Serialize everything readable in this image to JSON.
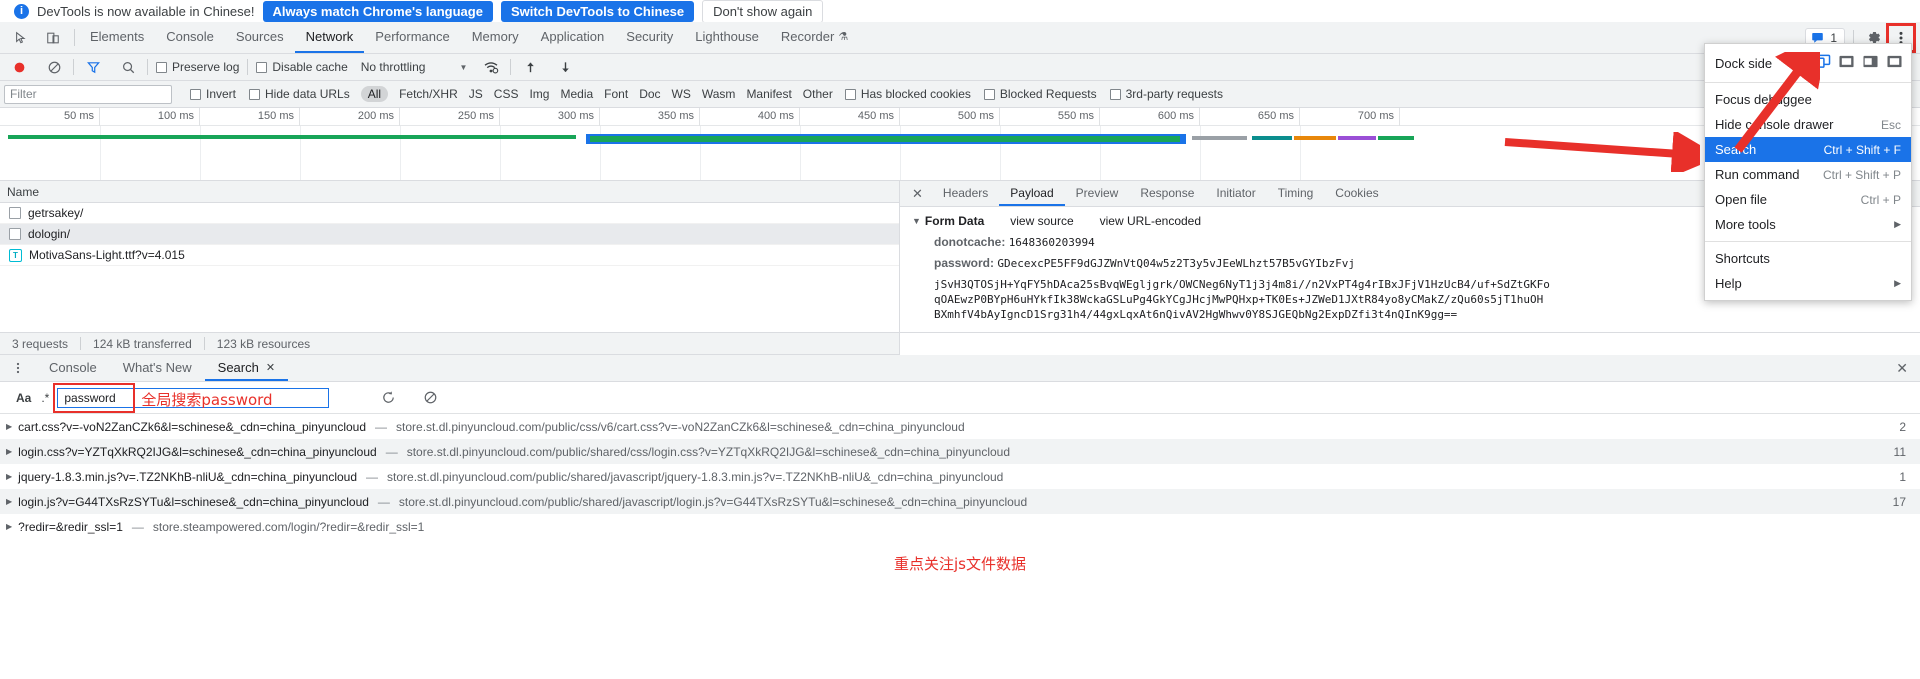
{
  "banner": {
    "icon": "info-icon",
    "text": "DevTools is now available in Chinese!",
    "primary_btn": "Always match Chrome's language",
    "secondary_btn": "Switch DevTools to Chinese",
    "dismiss_btn": "Don't show again"
  },
  "tabbar": {
    "inspect_icon": "inspect-cursor-icon",
    "device_icon": "device-toolbar-icon",
    "tabs": [
      {
        "label": "Elements",
        "active": false
      },
      {
        "label": "Console",
        "active": false
      },
      {
        "label": "Sources",
        "active": false
      },
      {
        "label": "Network",
        "active": true
      },
      {
        "label": "Performance",
        "active": false
      },
      {
        "label": "Memory",
        "active": false
      },
      {
        "label": "Application",
        "active": false
      },
      {
        "label": "Security",
        "active": false
      },
      {
        "label": "Lighthouse",
        "active": false
      },
      {
        "label": "Recorder",
        "active": false,
        "flask": "⚗"
      }
    ],
    "message_count": "1",
    "message_icon": "message-icon",
    "settings_icon": "gear-icon",
    "more_icon": "three-dots-vertical-icon"
  },
  "network_toolbar": {
    "record_icon": "record-circle-icon",
    "clear_icon": "clear-forbidden-icon",
    "filter_icon": "funnel-icon",
    "search_icon": "magnifier-icon",
    "preserve_log": "Preserve log",
    "disable_cache": "Disable cache",
    "throttling": "No throttling",
    "wifi_icon": "network-conditions-icon",
    "import_icon": "upload-arrow-icon",
    "export_icon": "download-arrow-icon"
  },
  "filter_bar": {
    "placeholder": "Filter",
    "invert": "Invert",
    "hide_data_urls": "Hide data URLs",
    "types": [
      "All",
      "Fetch/XHR",
      "JS",
      "CSS",
      "Img",
      "Media",
      "Font",
      "Doc",
      "WS",
      "Wasm",
      "Manifest",
      "Other"
    ],
    "selected_type": "All",
    "has_blocked_cookies": "Has blocked cookies",
    "blocked_requests": "Blocked Requests",
    "third_party": "3rd-party requests"
  },
  "timeline": {
    "ticks": [
      "50 ms",
      "100 ms",
      "150 ms",
      "200 ms",
      "250 ms",
      "300 ms",
      "350 ms",
      "400 ms",
      "450 ms",
      "500 ms",
      "550 ms",
      "600 ms",
      "650 ms",
      "700 ms"
    ]
  },
  "requests": {
    "column_header": "Name",
    "rows": [
      {
        "name": "getrsakey/",
        "icon": "document-icon"
      },
      {
        "name": "dologin/",
        "icon": "document-icon"
      },
      {
        "name": "MotivaSans-Light.ttf?v=4.015",
        "icon": "font-icon"
      }
    ]
  },
  "detail": {
    "close_icon": "close-x-icon",
    "tabs": [
      "Headers",
      "Payload",
      "Preview",
      "Response",
      "Initiator",
      "Timing",
      "Cookies"
    ],
    "active_tab": "Payload",
    "form_data_title": "Form Data",
    "view_source": "view source",
    "view_url_encoded": "view URL-encoded",
    "fields": [
      {
        "key": "donotcache:",
        "value": "1648360203994"
      },
      {
        "key": "password:",
        "value": "GDecexcPE5FF9dGJZWnVtQ04w5z2T3y5vJEeWLhzt57B5vGYIbzFvj"
      }
    ],
    "wrapped_lines": [
      "jSvH3QTOSjH+YqFY5hDAca25sBvqWEgljgrk/OWCNeg6NyT1j3j4m8i//n2VxPT4g4rIBxJFjV1HzUcB4/uf+SdZtGKFo",
      "qOAEwzP0BYpH6uHYkfIk38WckaGSLuPg4GkYCgJHcjMwPQHxp+TK0Es+JZWeD1JXtR84yo8yCMakZ/zQu60s5jT1huOH",
      "BXmhfV4bAyIgncD1Srg31h4/44gxLqxAt6nQivAV2HgWhwv0Y8SJGEQbNg2ExpDZfi3t4nQInK9gg=="
    ]
  },
  "status_bar": {
    "requests": "3 requests",
    "transferred": "124 kB transferred",
    "resources": "123 kB resources"
  },
  "drawer": {
    "menu_icon": "three-dots-vertical-icon",
    "tabs": [
      {
        "label": "Console",
        "active": false
      },
      {
        "label": "What's New",
        "active": false
      },
      {
        "label": "Search",
        "active": true,
        "closeable": true
      }
    ],
    "close_icon": "close-x-icon"
  },
  "search_panel": {
    "match_case_label": "Aa",
    "regex_label": ".*",
    "query": "password",
    "annotation": "全局搜索password",
    "refresh_icon": "refresh-icon",
    "clear_icon": "clear-forbidden-icon"
  },
  "search_results": [
    {
      "name": "cart.css?v=-voN2ZanCZk6&l=schinese&_cdn=china_pinyuncloud",
      "url": "store.st.dl.pinyuncloud.com/public/css/v6/cart.css?v=-voN2ZanCZk6&l=schinese&_cdn=china_pinyuncloud",
      "count": "2"
    },
    {
      "name": "login.css?v=YZTqXkRQ2IJG&l=schinese&_cdn=china_pinyuncloud",
      "url": "store.st.dl.pinyuncloud.com/public/shared/css/login.css?v=YZTqXkRQ2IJG&l=schinese&_cdn=china_pinyuncloud",
      "count": "11"
    },
    {
      "name": "jquery-1.8.3.min.js?v=.TZ2NKhB-nliU&_cdn=china_pinyuncloud",
      "url": "store.st.dl.pinyuncloud.com/public/shared/javascript/jquery-1.8.3.min.js?v=.TZ2NKhB-nliU&_cdn=china_pinyuncloud",
      "count": "1"
    },
    {
      "name": "login.js?v=G44TXsRzSYTu&l=schinese&_cdn=china_pinyuncloud",
      "url": "store.st.dl.pinyuncloud.com/public/shared/javascript/login.js?v=G44TXsRzSYTu&l=schinese&_cdn=china_pinyuncloud",
      "count": "17"
    },
    {
      "name": "?redir=&redir_ssl=1",
      "url": "store.steampowered.com/login/?redir=&redir_ssl=1",
      "count": ""
    }
  ],
  "footnote": "重点关注js文件数据",
  "menu": {
    "dock_side_label": "Dock side",
    "dock_options": [
      "undock-icon",
      "dock-bottom-icon",
      "dock-left-icon",
      "dock-right-icon"
    ],
    "items": [
      {
        "label": "Focus debuggee",
        "accel": "",
        "selected": false,
        "submenu": false
      },
      {
        "label": "Hide console drawer",
        "accel": "Esc",
        "selected": false,
        "submenu": false
      },
      {
        "label": "Search",
        "accel": "Ctrl + Shift + F",
        "selected": true,
        "submenu": false
      },
      {
        "label": "Run command",
        "accel": "Ctrl + Shift + P",
        "selected": false,
        "submenu": false
      },
      {
        "label": "Open file",
        "accel": "Ctrl + P",
        "selected": false,
        "submenu": false
      },
      {
        "label": "More tools",
        "accel": "",
        "selected": false,
        "submenu": true
      }
    ],
    "items2": [
      {
        "label": "Shortcuts",
        "accel": "",
        "selected": false,
        "submenu": false
      },
      {
        "label": "Help",
        "accel": "",
        "selected": false,
        "submenu": true
      }
    ]
  },
  "colors": {
    "accent": "#1a73e8",
    "annotation_red": "#e8302a",
    "toolbar_bg": "#f1f3f4"
  }
}
